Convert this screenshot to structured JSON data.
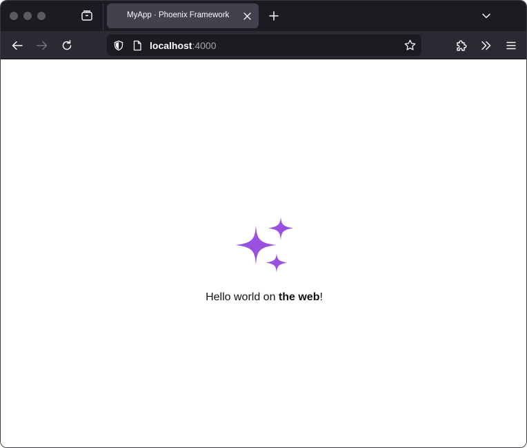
{
  "browser": {
    "tab": {
      "title": "MyApp · Phoenix Framework"
    },
    "url": {
      "host": "localhost",
      "port": ":4000"
    }
  },
  "page": {
    "greeting": {
      "prefix": "Hello world on ",
      "emphasis": "the web",
      "suffix": "!"
    },
    "accent_color": "#9b51e0"
  },
  "icons": {
    "tabs": "tab-overview-icon",
    "close_tab": "close-icon",
    "new_tab": "plus-icon",
    "tab_list": "chevron-down-icon",
    "back": "arrow-left-icon",
    "forward": "arrow-right-icon",
    "reload": "reload-icon",
    "shield": "shield-icon",
    "page": "page-icon",
    "bookmark": "star-icon",
    "extensions": "puzzle-icon",
    "overflow": "double-chevron-icon",
    "menu": "hamburger-icon",
    "hero": "sparkles-icon"
  }
}
